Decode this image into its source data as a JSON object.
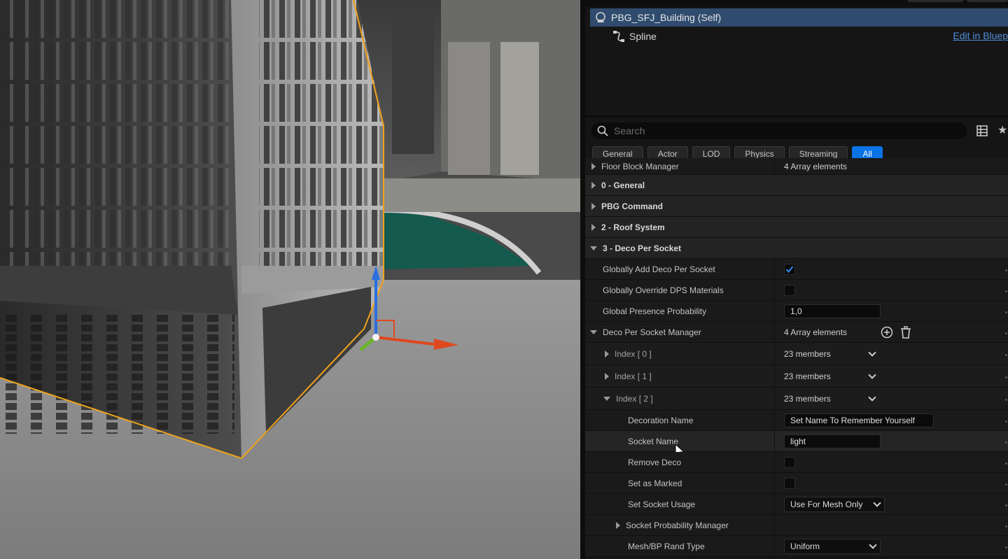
{
  "components": {
    "self_label": "PBG_SFJ_Building (Self)",
    "spline_label": "Spline",
    "edit_link": "Edit in Bluep"
  },
  "search": {
    "placeholder": "Search"
  },
  "filter_tabs": [
    "General",
    "Actor",
    "LOD",
    "Physics",
    "Streaming",
    "All"
  ],
  "active_tab": "All",
  "details": {
    "floor_block_manager": {
      "label": "Floor Block Manager",
      "value": "4 Array elements"
    },
    "categories": {
      "general": "0 - General",
      "pbg_command": "PBG Command",
      "roof_system": "2 - Roof System",
      "deco_per_socket": "3 - Deco Per Socket"
    },
    "globally_add_deco": {
      "label": "Globally Add Deco Per Socket",
      "checked": true
    },
    "globally_override_dps": {
      "label": "Globally Override DPS Materials",
      "checked": false
    },
    "global_presence_probability": {
      "label": "Global Presence Probability",
      "value": "1,0"
    },
    "deco_per_socket_manager": {
      "label": "Deco Per Socket Manager",
      "value": "4 Array elements"
    },
    "index_0": {
      "label": "Index [ 0 ]",
      "value": "23 members"
    },
    "index_1": {
      "label": "Index [ 1 ]",
      "value": "23 members"
    },
    "index_2": {
      "label": "Index [ 2 ]",
      "value": "23 members"
    },
    "decoration_name": {
      "label": "Decoration Name",
      "value": "Set Name To Remember Yourself"
    },
    "socket_name": {
      "label": "Socket Name",
      "value": "light"
    },
    "remove_deco": {
      "label": "Remove Deco",
      "checked": false
    },
    "set_as_marked": {
      "label": "Set as Marked",
      "checked": false
    },
    "set_socket_usage": {
      "label": "Set Socket Usage",
      "value": "Use For Mesh Only"
    },
    "socket_probability_manager": {
      "label": "Socket Probability Manager"
    },
    "mesh_bp_rand_type": {
      "label": "Mesh/BP Rand Type",
      "value": "Uniform"
    }
  },
  "colors": {
    "selection": "#2f4c6e",
    "accent": "#0b74e5",
    "link": "#4e8fdd",
    "gizmo_x": "#e0481f",
    "gizmo_y": "#6ab42a",
    "gizmo_z": "#2a6fe0",
    "selection_outline": "#f0a21c"
  }
}
